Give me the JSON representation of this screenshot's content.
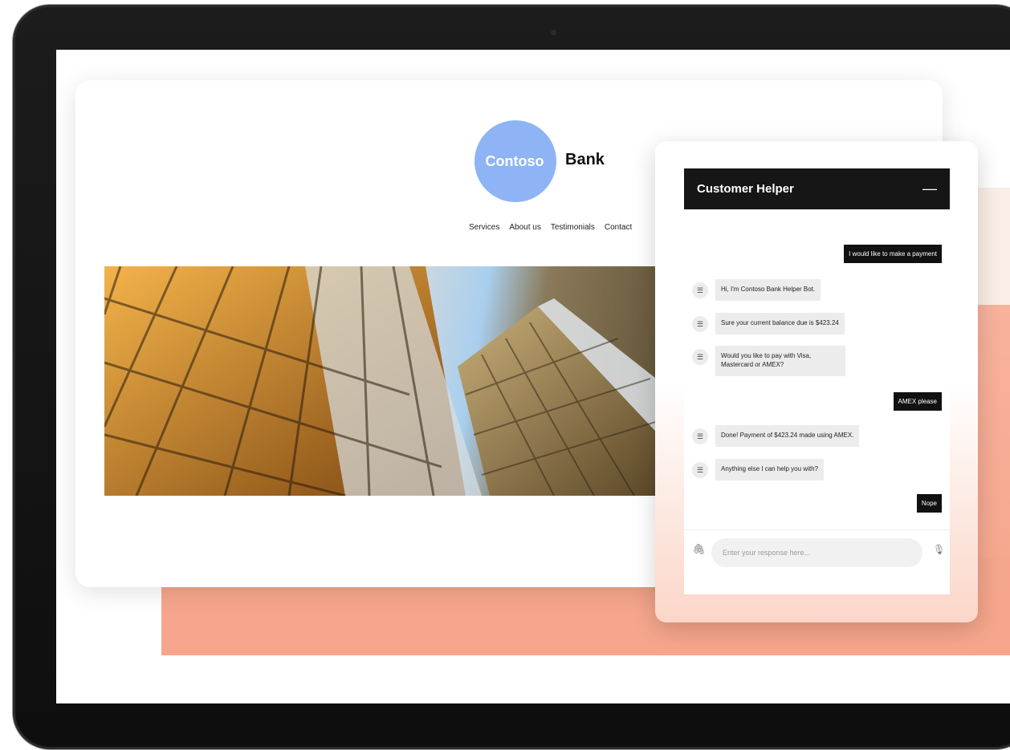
{
  "site": {
    "logo_word": "Contoso",
    "logo_bank": "Bank",
    "nav": [
      "Services",
      "About us",
      "Testimonials",
      "Contact"
    ]
  },
  "chat": {
    "title": "Customer Helper",
    "minimize": "—",
    "messages": [
      {
        "from": "user",
        "text": "I would like to make a payment"
      },
      {
        "from": "bot",
        "text": "Hi, I'm Contoso Bank Helper Bot."
      },
      {
        "from": "bot",
        "text": "Sure your current balance due is $423.24"
      },
      {
        "from": "bot",
        "text": "Would you like to pay with Visa, Mastercard or AMEX?"
      },
      {
        "from": "user",
        "text": "AMEX please"
      },
      {
        "from": "bot",
        "text": "Done! Payment of $423.24 made using AMEX."
      },
      {
        "from": "bot",
        "text": "Anything else I can help you with?"
      },
      {
        "from": "user",
        "text": "Nope"
      }
    ],
    "input_placeholder": "Enter your response here...",
    "bot_avatar_icon": "bot-icon",
    "attach_icon": "paperclip-icon",
    "mic_icon": "microphone-icon"
  },
  "colors": {
    "logo_circle": "#8eb4f5",
    "accent_salmon": "#f6a68c",
    "chat_header": "#161616"
  }
}
